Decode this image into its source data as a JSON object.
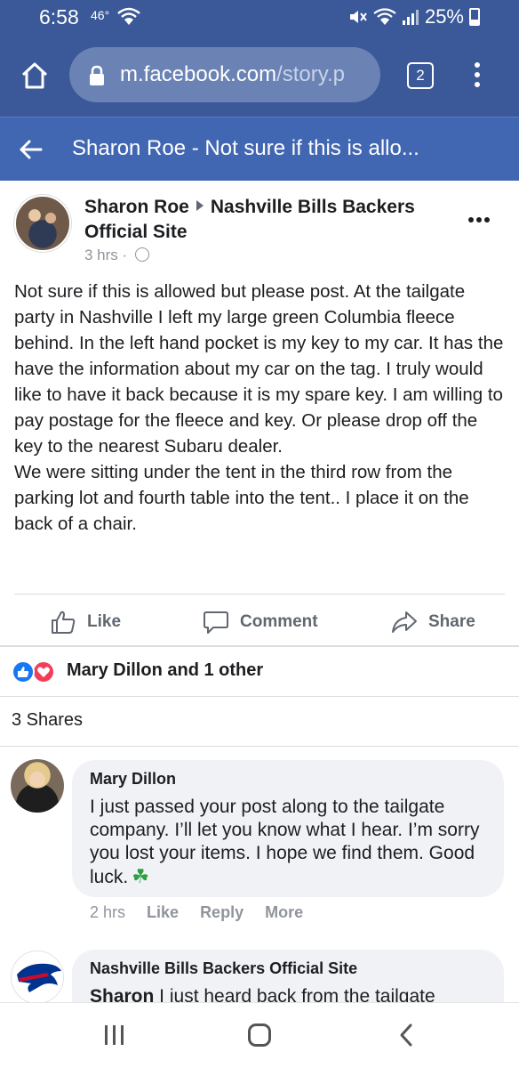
{
  "status_bar": {
    "time": "6:58",
    "temp": "46°",
    "battery": "25%"
  },
  "browser": {
    "url_main": "m.facebook.com",
    "url_path": "/story.p",
    "tab_count": "2"
  },
  "header": {
    "title": "Sharon Roe - Not sure if this is allo..."
  },
  "post": {
    "author": "Sharon Roe",
    "group": "Nashville Bills Backers Official Site",
    "time": "3 hrs ·",
    "body_p1": "Not sure if this is allowed but please post. At the tailgate party in Nashville I left my large green Columbia fleece behind. In the left hand pocket is my key to my car. It has the have the information about my car on the tag. I truly would like to have it back because it is my spare key. I am willing to pay postage for the fleece and key. Or please drop off the key to the nearest Subaru dealer.",
    "body_p2": "We were sitting under the tent in the third row from the parking lot and fourth table into the tent.. I place it on the back of a chair.",
    "actions": {
      "like": "Like",
      "comment": "Comment",
      "share": "Share"
    },
    "reactions_text": "Mary Dillon and 1 other",
    "shares_text": "3 Shares"
  },
  "comments": [
    {
      "name": "Mary Dillon",
      "text": "I just passed your post along to the tailgate company. I’ll let you know what I hear. I’m sorry you lost your items. I hope we find them. Good luck.",
      "time": "2 hrs",
      "like": "Like",
      "reply": "Reply",
      "more": "More"
    },
    {
      "name": "Nashville Bills Backers Official Site",
      "text_bold": "Sharon",
      "text": " I just heard back from the tailgate"
    }
  ],
  "colors": {
    "header_blue": "#3b5998",
    "page_header_blue": "#4267b2",
    "like_blue": "#1877f2",
    "love_red": "#f33e58"
  }
}
